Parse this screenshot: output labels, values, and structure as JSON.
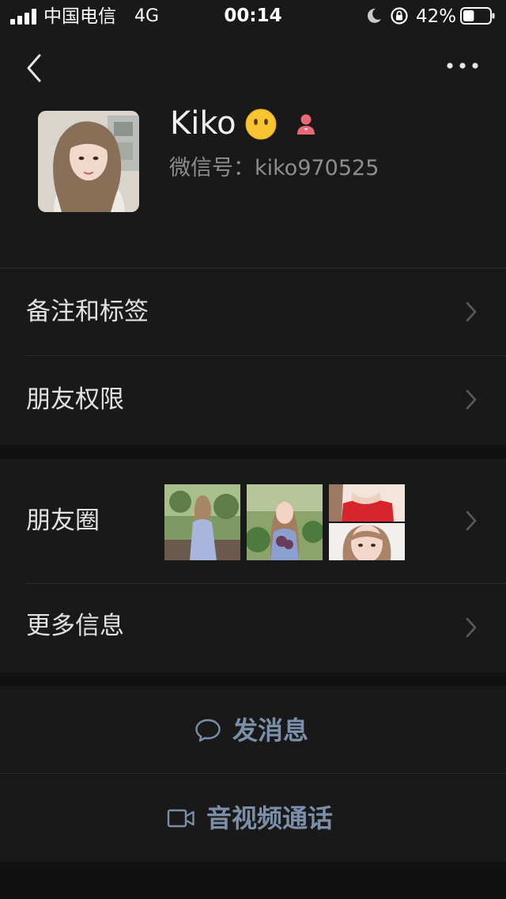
{
  "status_bar": {
    "carrier": "中国电信",
    "network": "4G",
    "time": "00:14",
    "battery": "42%",
    "battery_level": 0.42
  },
  "nav": {
    "back_icon": "chevron-left-icon",
    "more_icon": "ellipsis-icon"
  },
  "profile": {
    "name": "Kiko",
    "name_emoji": "😶",
    "gender_icon": "female-icon",
    "wechat_id_label": "微信号：",
    "wechat_id": "kiko970525"
  },
  "rows": {
    "remarks_tags": "备注和标签",
    "friend_permissions": "朋友权限",
    "moments": "朋友圈",
    "more_info": "更多信息"
  },
  "actions": {
    "send_message": "发消息",
    "av_call": "音视频通话"
  },
  "colors": {
    "background": "#111111",
    "card": "#191919",
    "action_text": "#7c8fa8",
    "secondary_text": "#8d8d8d"
  }
}
